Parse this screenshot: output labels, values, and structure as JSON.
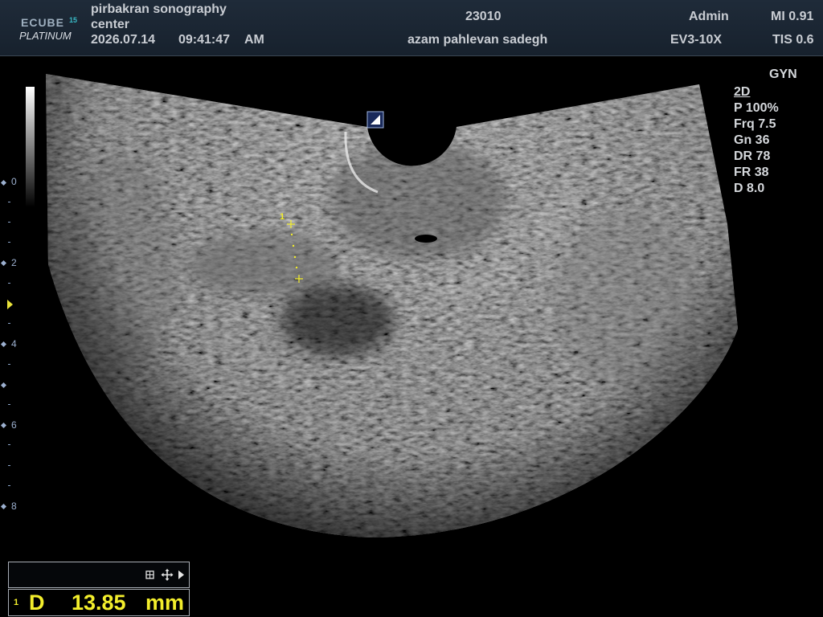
{
  "header": {
    "logo_main": "ECUBE",
    "logo_number": "15",
    "logo_sub": "PLATINUM",
    "facility_line1": "pirbakran sonography",
    "facility_line2": "center",
    "date": "2026.07.14",
    "time": "09:41:47",
    "ampm": "AM",
    "patient_id": "23010",
    "patient_name": "azam pahlevan sadegh",
    "operator": "Admin",
    "probe": "EV3-10X",
    "mi": "MI 0.91",
    "tis": "TIS 0.6"
  },
  "imaging": {
    "preset": "GYN",
    "mode": "2D",
    "params": [
      "P 100%",
      "Frq 7.5",
      "Gn 36",
      "DR 78",
      "FR 38",
      "D 8.0"
    ]
  },
  "depth_scale": {
    "labels": [
      "0",
      "2",
      "4",
      "6",
      "8"
    ]
  },
  "caliper": {
    "label": "1"
  },
  "measurement": {
    "index": "1",
    "type": "D",
    "value": "13.85",
    "unit": "mm"
  },
  "icons": [
    "grid-icon",
    "move-icon",
    "play-arrow-icon",
    "orientation-marker-icon"
  ],
  "colors": {
    "caliper": "#f3ee2c",
    "header_bg": "#1b2633",
    "scale": "#9cb0cf"
  }
}
